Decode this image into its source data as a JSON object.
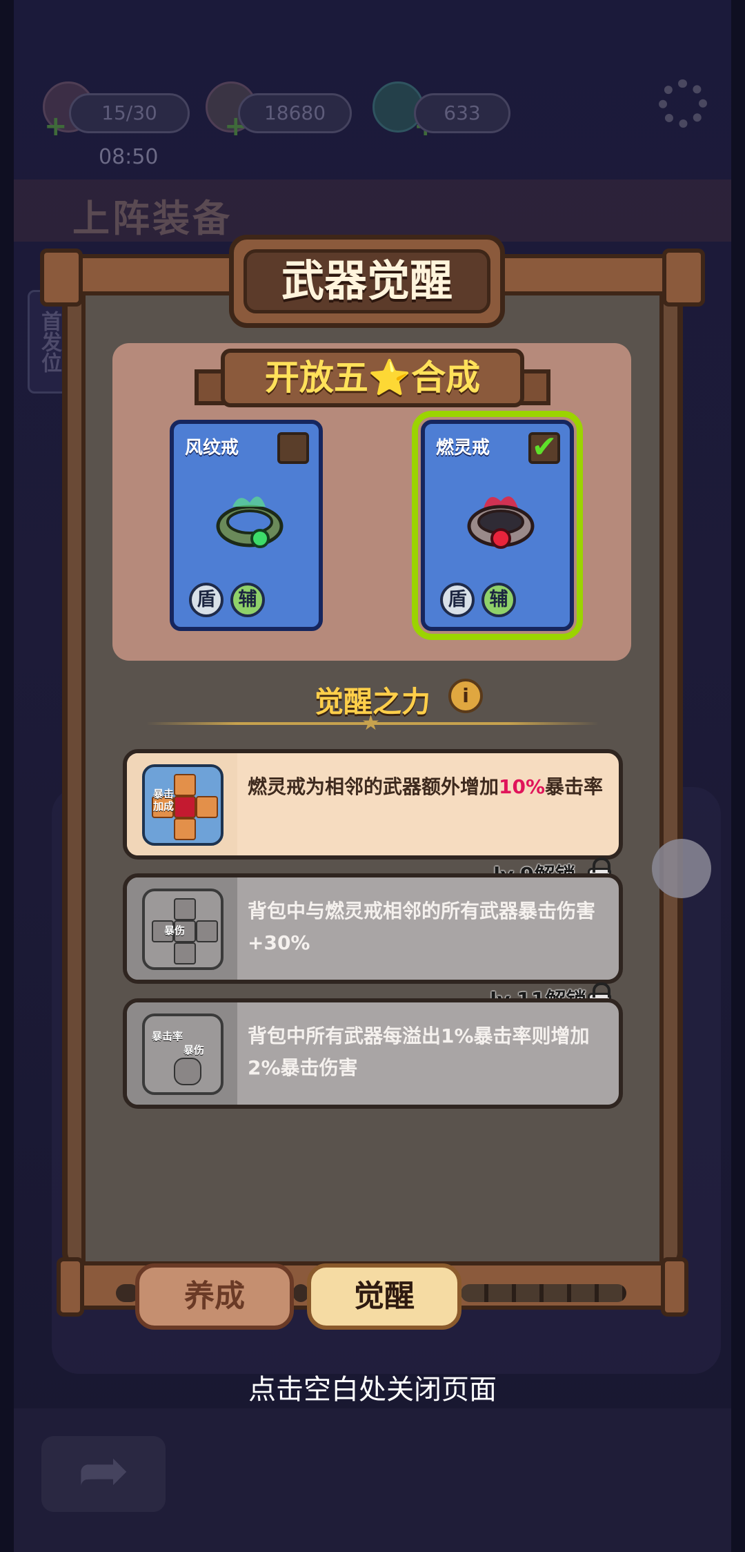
{
  "hud": {
    "stamina": "15/30",
    "gold": "18680",
    "gems": "633",
    "time": "08:50"
  },
  "background": {
    "section_title": "上阵装备",
    "side_tab": "首发位"
  },
  "modal": {
    "title": "武器觉醒",
    "synthesis_banner": "开放五⭐合成",
    "cards": [
      {
        "name": "风纹戒",
        "checked": false,
        "tags": [
          "盾",
          "辅"
        ],
        "gem_color": "#3ddc6a"
      },
      {
        "name": "燃灵戒",
        "checked": true,
        "tags": [
          "盾",
          "辅"
        ],
        "gem_color": "#e8243c"
      }
    ],
    "power_title": "觉醒之力",
    "skills": [
      {
        "text_pre": "燃灵戒为相邻的武器额外增加",
        "text_hl": "10%",
        "text_post": "暴击率",
        "icon_label_a": "暴击",
        "icon_label_b": "加成",
        "status": "unlocked"
      },
      {
        "text": "背包中与燃灵戒相邻的所有武器暴击伤害+30%",
        "icon_label_a": "暴伤",
        "lock_label": "lv.9解锁",
        "status": "locked"
      },
      {
        "text": "背包中所有武器每溢出1%暴击率则增加2%暴击伤害",
        "icon_label_a": "暴击率",
        "icon_label_b": "暴伤",
        "lock_label": "lv.11解锁",
        "status": "locked"
      }
    ],
    "tabs": [
      {
        "label": "养成",
        "active": false
      },
      {
        "label": "觉醒",
        "active": true
      }
    ],
    "close_hint": "点击空白处关闭页面"
  },
  "colors": {
    "highlight": "#e0145a",
    "selected_border": "#9bd400",
    "card_blue": "#4e7ed4"
  }
}
